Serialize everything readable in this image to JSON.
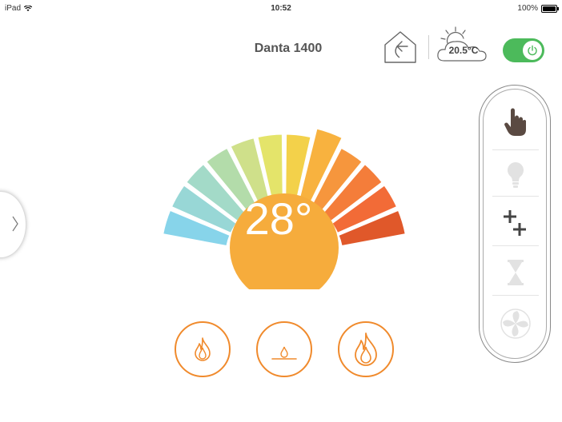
{
  "status_bar": {
    "device": "iPad",
    "time": "10:52",
    "battery": "100%",
    "battery_level": 1.0
  },
  "header": {
    "title": "Danta 1400",
    "outdoor_temp": "20.5°C",
    "power_on": true
  },
  "thermostat": {
    "set_temperature": "28°",
    "selected_segment": 7,
    "segment_colors": [
      "#87d4ea",
      "#98d7d6",
      "#a3dac8",
      "#b3dcaa",
      "#cfe08a",
      "#e4e46a",
      "#f3d14a",
      "#f8b23f",
      "#f6963d",
      "#f47d3a",
      "#f26b37",
      "#e0582a"
    ]
  },
  "heat_modes": [
    {
      "name": "medium-flame"
    },
    {
      "name": "low-flame"
    },
    {
      "name": "high-flame"
    }
  ],
  "side_panel": {
    "items": [
      "manual-hand-icon",
      "lightbulb-icon",
      "plus-plus-icon",
      "hourglass-icon",
      "fan-icon"
    ],
    "active": "manual-hand-icon"
  },
  "colors": {
    "accent_orange": "#f08a2c",
    "toggle_green": "#4cba5b",
    "temp_circle": "#f6ac3c"
  }
}
